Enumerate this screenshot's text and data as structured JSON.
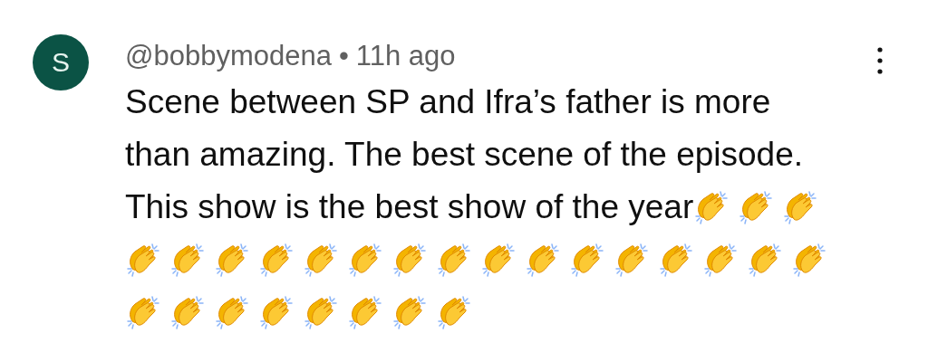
{
  "comment": {
    "avatar_letter": "S",
    "author": "@bobbymodena",
    "separator": "•",
    "time": "11h ago",
    "text_lines": [
      "Scene between SP and Ifra’s father is more",
      "than amazing. The best scene of the episode.",
      "This show is the best show of the year"
    ],
    "emojis": [
      {
        "kind": "clap"
      },
      {
        "kind": "clap"
      },
      {
        "kind": "clap"
      },
      {
        "kind": "clap"
      },
      {
        "kind": "clap"
      },
      {
        "kind": "clap"
      },
      {
        "kind": "clap"
      },
      {
        "kind": "clap"
      },
      {
        "kind": "clap"
      },
      {
        "kind": "clap"
      },
      {
        "kind": "clap"
      },
      {
        "kind": "clap"
      },
      {
        "kind": "clap"
      },
      {
        "kind": "clap"
      },
      {
        "kind": "clap"
      },
      {
        "kind": "clap"
      },
      {
        "kind": "clap"
      },
      {
        "kind": "clap"
      },
      {
        "kind": "clap"
      },
      {
        "kind": "clap"
      },
      {
        "kind": "clap"
      },
      {
        "kind": "clap"
      },
      {
        "kind": "clap"
      },
      {
        "kind": "clap"
      },
      {
        "kind": "clap"
      },
      {
        "kind": "clap"
      },
      {
        "kind": "clap"
      }
    ]
  }
}
